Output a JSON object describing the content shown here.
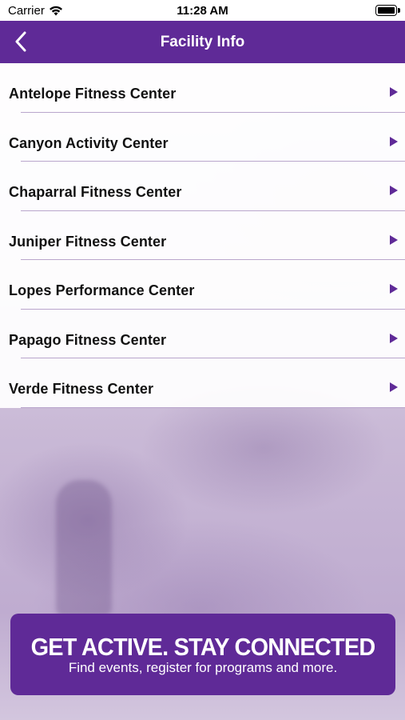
{
  "status_bar": {
    "carrier": "Carrier",
    "time": "11:28 AM"
  },
  "nav": {
    "title": "Facility Info",
    "back_icon": "chevron-left-icon"
  },
  "facilities": [
    {
      "label": "Antelope Fitness Center"
    },
    {
      "label": "Canyon Activity Center"
    },
    {
      "label": "Chaparral Fitness Center"
    },
    {
      "label": "Juniper Fitness Center"
    },
    {
      "label": "Lopes Performance Center"
    },
    {
      "label": "Papago Fitness Center"
    },
    {
      "label": "Verde Fitness Center"
    }
  ],
  "banner": {
    "headline": "GET ACTIVE.  STAY CONNECTED",
    "subtext": "Find events, register for programs and more."
  },
  "colors": {
    "brand_purple": "#5f2a97",
    "separator": "#b9a6cc"
  }
}
